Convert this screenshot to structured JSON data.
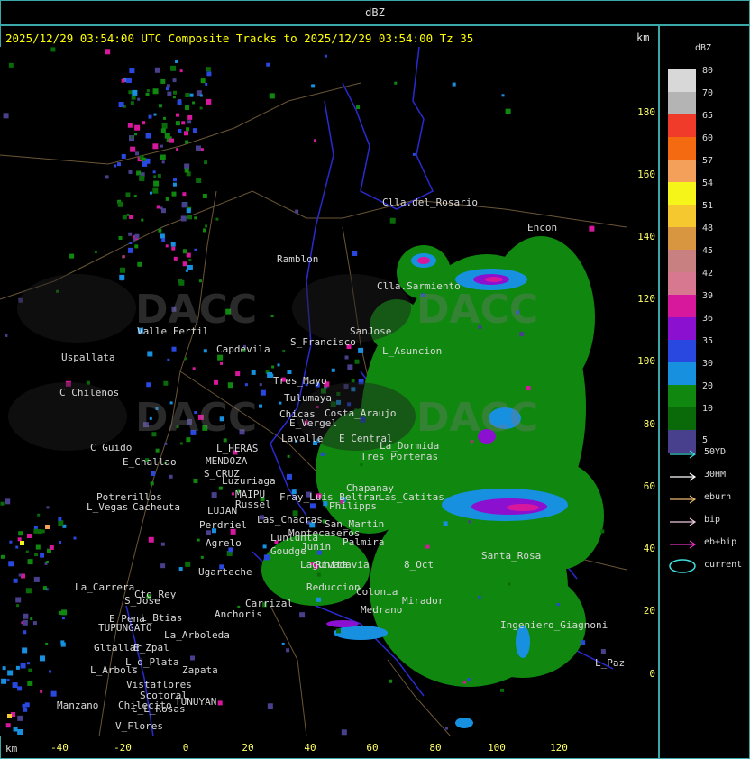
{
  "title_bar": "dBZ",
  "status_line": "2025/12/29 03:54:00 UTC Composite Tracks to 2025/12/29 03:54:00 Tz 35",
  "unit_top": "km",
  "unit_bottom": "km",
  "y_ticks": [
    "180",
    "160",
    "140",
    "120",
    "100",
    "80",
    "60",
    "40",
    "20",
    "0"
  ],
  "x_ticks": [
    "-40",
    "-20",
    "0",
    "20",
    "40",
    "60",
    "80",
    "100",
    "120"
  ],
  "legend": {
    "title": "dBZ",
    "scale": [
      {
        "label": "80",
        "color": "#d8d8d8"
      },
      {
        "label": "70",
        "color": "#b4b4b4"
      },
      {
        "label": "65",
        "color": "#f03a2a"
      },
      {
        "label": "60",
        "color": "#f46a10"
      },
      {
        "label": "57",
        "color": "#f5a05a"
      },
      {
        "label": "54",
        "color": "#f5f51a"
      },
      {
        "label": "51",
        "color": "#f5c830"
      },
      {
        "label": "48",
        "color": "#d89640"
      },
      {
        "label": "45",
        "color": "#c88080"
      },
      {
        "label": "42",
        "color": "#d87890"
      },
      {
        "label": "39",
        "color": "#d8189c"
      },
      {
        "label": "36",
        "color": "#8c10d0"
      },
      {
        "label": "35",
        "color": "#2848e0"
      },
      {
        "label": "30",
        "color": "#1890e0"
      },
      {
        "label": "20",
        "color": "#108810"
      },
      {
        "label": "10",
        "color": "#0a6a0a"
      },
      {
        "label": "5",
        "color": "#48408c"
      }
    ],
    "tracks": [
      {
        "label": "50YD",
        "color": "#40d8d8"
      },
      {
        "label": "30HM",
        "color": "#ffffff"
      },
      {
        "label": "eburn",
        "color": "#e8b870"
      },
      {
        "label": "bip",
        "color": "#f0c8e0"
      },
      {
        "label": "eb+bip",
        "color": "#e030c0"
      },
      {
        "label": "current",
        "color": "#40e0e0"
      }
    ]
  },
  "watermarks": [
    "DACC",
    "DACC",
    "DACC",
    "DACC"
  ],
  "places": [
    "Clla.del_Rosario",
    "Encon",
    "Ramblon",
    "Clla.Sarmiento",
    "SanJose",
    "Valle Fertil",
    "S_Francisco",
    "L_Asuncion",
    "Capdevila",
    "Uspallata",
    "C_Chilenos",
    "Tres_Mayo",
    "Tulumaya",
    "Chicas",
    "E_Vergel",
    "Lavalle",
    "E_Central",
    "Costa_Araujo",
    "C_Guido",
    "E_Challao",
    "MENDOZA",
    "S_CRUZ",
    "L_HERAS",
    "Luzuriaga",
    "MAIPU",
    "Russel",
    "L_Vegas",
    "Potrerillos",
    "Cacheuta",
    "LUJAN",
    "Perdriel",
    "Agrelo",
    "Ugarteche",
    "La_Carrera",
    "Cto_Rey",
    "S_Jose",
    "E_Pena",
    "TUPUNGATO",
    "Anchoris",
    "L_Btias",
    "Carrizal",
    "La_Arboleda",
    "Gltallar",
    "E_Zpal",
    "L_d_Plata",
    "L_Arbols",
    "Zapata",
    "Manzano",
    "Vistaflores",
    "Scotoral",
    "TUNUYAN",
    "Chilecito",
    "C_L_Rosas",
    "V_Flores",
    "San_Martin",
    "Rivadavia",
    "Junin",
    "Medrano",
    "Mirador",
    "Santa_Rosa",
    "L_Paz",
    "La_Dormida",
    "Las_Catitas",
    "Palmira",
    "Chapanay",
    "Tres_Porteñas",
    "Ingeniero_Giagnoni",
    "8_Oct",
    "Colonia",
    "Philipps",
    "Reduccion",
    "Montecaseros",
    "Las_Chacras",
    "Lunlunta",
    "Fray_Luis_Beltran",
    "Goudge",
    "Lagunita",
    "Barriales"
  ]
}
